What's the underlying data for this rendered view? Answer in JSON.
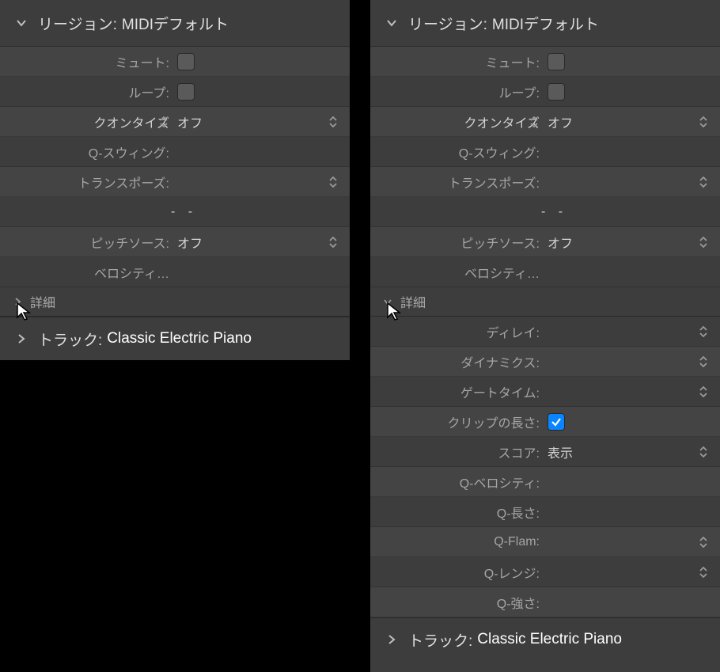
{
  "left": {
    "region": {
      "prefix": "リージョン:",
      "title": "MIDIデフォルト"
    },
    "params": {
      "mute": {
        "label": "ミュート:"
      },
      "loop": {
        "label": "ループ:"
      },
      "quantize": {
        "label": "クオンタイズ",
        "value": "オフ"
      },
      "qswing": {
        "label": "Q-スウィング:"
      },
      "transpose": {
        "label": "トランスポーズ:"
      },
      "dashes": {
        "value": "-  -"
      },
      "pitchsource": {
        "label": "ピッチソース:",
        "value": "オフ"
      },
      "velocity": {
        "label": "ベロシティ…"
      }
    },
    "detail": {
      "label": "詳細"
    },
    "track": {
      "prefix": "トラック:",
      "name": "Classic Electric Piano"
    }
  },
  "right": {
    "region": {
      "prefix": "リージョン:",
      "title": "MIDIデフォルト"
    },
    "params": {
      "mute": {
        "label": "ミュート:"
      },
      "loop": {
        "label": "ループ:"
      },
      "quantize": {
        "label": "クオンタイズ",
        "value": "オフ"
      },
      "qswing": {
        "label": "Q-スウィング:"
      },
      "transpose": {
        "label": "トランスポーズ:"
      },
      "dashes": {
        "value": "-  -"
      },
      "pitchsource": {
        "label": "ピッチソース:",
        "value": "オフ"
      },
      "velocity": {
        "label": "ベロシティ…"
      }
    },
    "detail": {
      "label": "詳細"
    },
    "detail_params": {
      "delay": {
        "label": "ディレイ:"
      },
      "dynamics": {
        "label": "ダイナミクス:"
      },
      "gatetime": {
        "label": "ゲートタイム:"
      },
      "cliplength": {
        "label": "クリップの長さ:"
      },
      "score": {
        "label": "スコア:",
        "value": "表示"
      },
      "qvelocity": {
        "label": "Q-ベロシティ:"
      },
      "qlength": {
        "label": "Q-長さ:"
      },
      "qflam": {
        "label": "Q-Flam:"
      },
      "qrange": {
        "label": "Q-レンジ:"
      },
      "qstrength": {
        "label": "Q-強さ:"
      }
    },
    "track": {
      "prefix": "トラック:",
      "name": "Classic Electric Piano"
    }
  }
}
